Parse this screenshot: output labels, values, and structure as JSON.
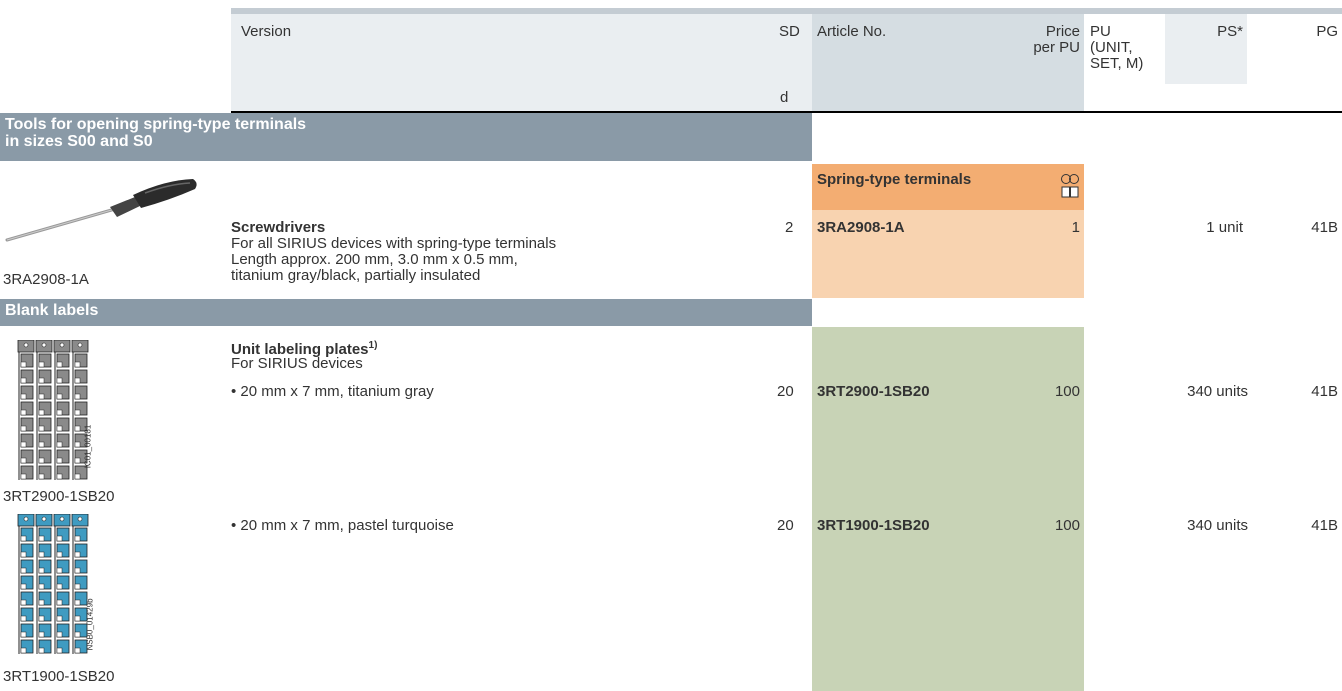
{
  "header": {
    "version": "Version",
    "sd": "SD",
    "sd_unit": "d",
    "article_no": "Article No.",
    "price_line1": "Price",
    "price_line2": "per PU",
    "pu_line1": "PU",
    "pu_line2": "(UNIT,",
    "pu_line3": "SET, M)",
    "ps": "PS*",
    "pg": "PG"
  },
  "sections": [
    {
      "title_line1": "Tools for opening spring-type terminals",
      "title_line2": "in sizes S00 and S0"
    },
    {
      "title_line1": "Blank labels"
    }
  ],
  "screwdriver": {
    "image_caption": "3RA2908-1A",
    "subheader": "Spring-type terminals",
    "title": "Screwdrivers",
    "desc1": "For all SIRIUS devices with spring-type terminals",
    "desc2": "Length approx. 200 mm, 3.0 mm x 0.5 mm,",
    "desc3": "titanium gray/black, partially insulated",
    "sd": "2",
    "article": "3RA2908-1A",
    "pu": "1",
    "ps": "1 unit",
    "pg": "41B"
  },
  "labels": {
    "title": "Unit labeling plates",
    "title_sup": "1)",
    "desc": "For SIRIUS devices",
    "rows": [
      {
        "text": "• 20 mm x 7 mm, titanium gray",
        "sd": "20",
        "article": "3RT2900-1SB20",
        "pu": "100",
        "ps": "340 units",
        "pg": "41B",
        "image_caption": "3RT2900-1SB20",
        "image_code": "IC01_00181",
        "color": "#8a8a8a"
      },
      {
        "text": "• 20 mm x 7 mm, pastel turquoise",
        "sd": "20",
        "article": "3RT1900-1SB20",
        "pu": "100",
        "ps": "340 units",
        "pg": "41B",
        "image_caption": "3RT1900-1SB20",
        "image_code": "NSB0_01429b",
        "color": "#3f9bc1"
      }
    ]
  },
  "colors": {
    "section_bg": "#8a9aa7",
    "orange_header": "#f3ad72",
    "orange_body": "#f8d3b0",
    "green_body": "#c8d3b6"
  },
  "icons": [
    "spring-terminal-icon",
    "screwdriver-image",
    "label-plate-image"
  ]
}
